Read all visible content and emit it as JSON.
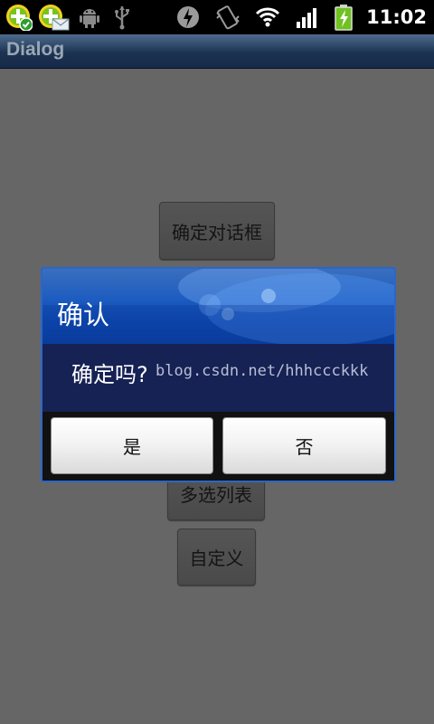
{
  "status_bar": {
    "time": "11:02",
    "left_icons": [
      "plus-check-icon",
      "plus-mail-icon",
      "android-debug-icon",
      "usb-icon"
    ],
    "right_icons": [
      "bolt-icon",
      "vibrate-icon",
      "wifi-icon",
      "signal-icon",
      "battery-icon"
    ]
  },
  "app": {
    "title": "Dialog"
  },
  "buttons": {
    "confirm_dialog": "确定对话框",
    "multi_select": "多选列表",
    "custom": "自定义"
  },
  "dialog": {
    "title": "确认",
    "message": "确定吗?",
    "watermark": "blog.csdn.net/hhhccckkk",
    "positive": "是",
    "negative": "否",
    "accent": "#2b66c9"
  }
}
